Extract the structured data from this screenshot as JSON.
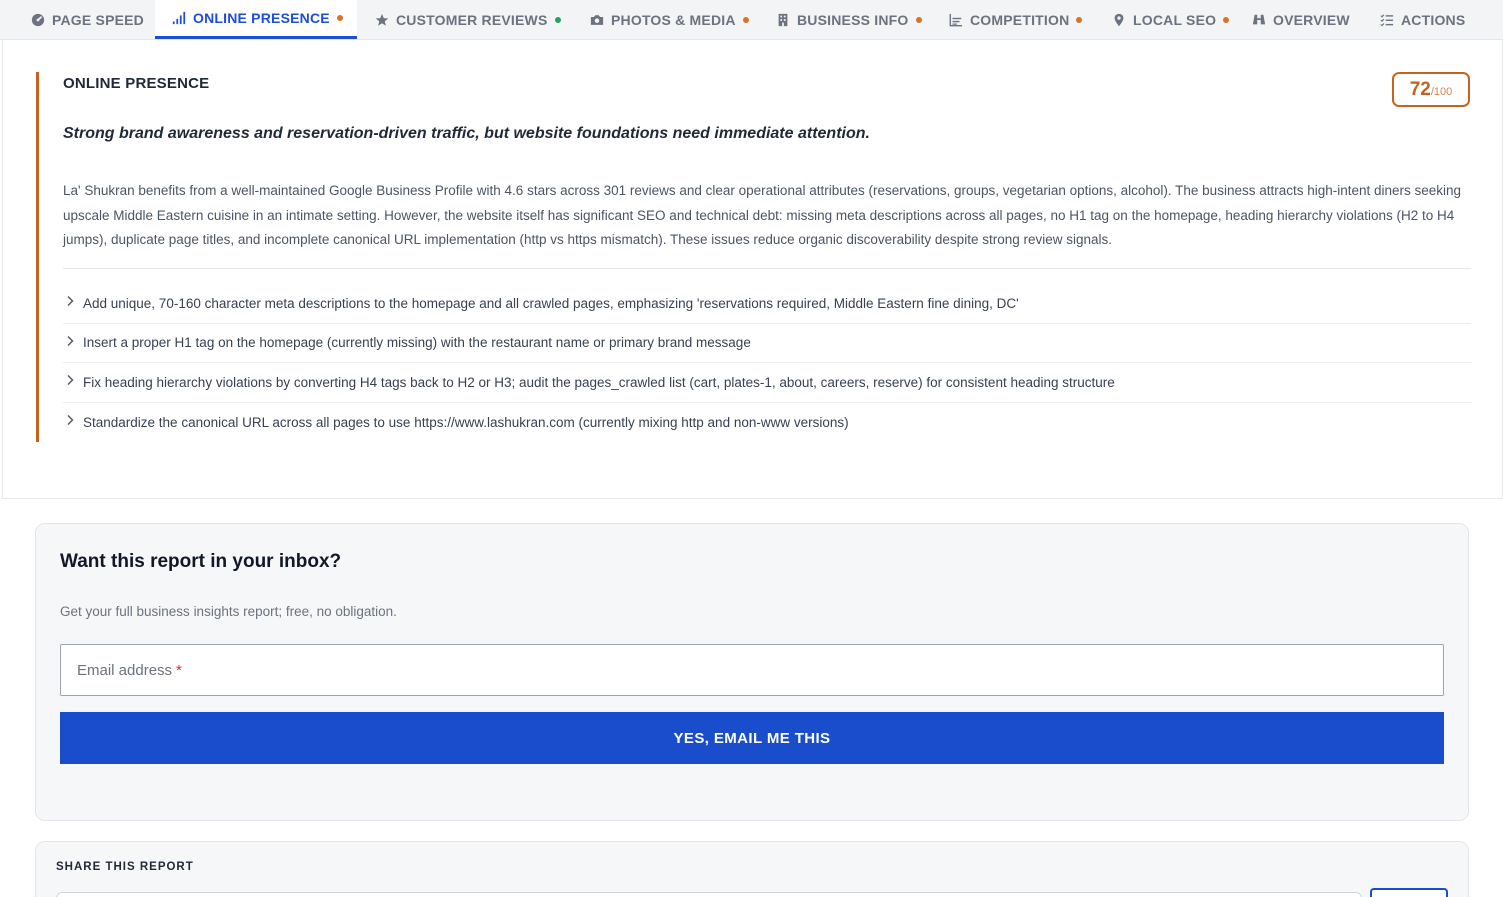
{
  "tabs": [
    {
      "label": "PAGE SPEED",
      "icon": "gauge-icon",
      "dot": null
    },
    {
      "label": "ONLINE PRESENCE",
      "icon": "signal-bars-icon",
      "dot": "#d9722b",
      "active": true
    },
    {
      "label": "CUSTOMER REVIEWS",
      "icon": "star-icon",
      "dot": "#22a55a"
    },
    {
      "label": "PHOTOS & MEDIA",
      "icon": "camera-icon",
      "dot": "#d9722b"
    },
    {
      "label": "BUSINESS INFO",
      "icon": "building-icon",
      "dot": "#d9722b"
    },
    {
      "label": "COMPETITION",
      "icon": "bar-chart-icon",
      "dot": "#d9722b"
    },
    {
      "label": "LOCAL SEO",
      "icon": "map-pin-icon",
      "dot": "#d9722b"
    },
    {
      "label": "OVERVIEW",
      "icon": "binoculars-icon",
      "dot": null
    },
    {
      "label": "ACTIONS",
      "icon": "checklist-icon",
      "dot": null
    }
  ],
  "section": {
    "title": "ONLINE PRESENCE",
    "score": "72",
    "score_max": "/100",
    "headline": "Strong brand awareness and reservation-driven traffic, but website foundations need immediate attention.",
    "summary": "La' Shukran benefits from a well-maintained Google Business Profile with 4.6 stars across 301 reviews and clear operational attributes (reservations, groups, vegetarian options, alcohol). The business attracts high-intent diners seeking upscale Middle Eastern cuisine in an intimate setting. However, the website itself has significant SEO and technical debt: missing meta descriptions across all pages, no H1 tag on the homepage, heading hierarchy violations (H2 to H4 jumps), duplicate page titles, and incomplete canonical URL implementation (http vs https mismatch). These issues reduce organic discoverability despite strong review signals.",
    "recommendations": [
      "Add unique, 70-160 character meta descriptions to the homepage and all crawled pages, emphasizing 'reservations required, Middle Eastern fine dining, DC'",
      "Insert a proper H1 tag on the homepage (currently missing) with the restaurant name or primary brand message",
      "Fix heading hierarchy violations by converting H4 tags back to H2 or H3; audit the pages_crawled list (cart, plates-1, about, careers, reserve) for consistent heading structure",
      "Standardize the canonical URL across all pages to use https://www.lashukran.com (currently mixing http and non-www versions)"
    ]
  },
  "email": {
    "title": "Want this report in your inbox?",
    "subtitle": "Get your full business insights report; free, no obligation.",
    "placeholder": "Email address",
    "required_mark": "*",
    "button": "YES, EMAIL ME THIS"
  },
  "share": {
    "title": "SHARE THIS REPORT"
  },
  "colors": {
    "accent_blue": "#1a4dcc",
    "accent_orange": "#c2631f",
    "status_orange": "#d9722b",
    "status_green": "#22a55a"
  }
}
